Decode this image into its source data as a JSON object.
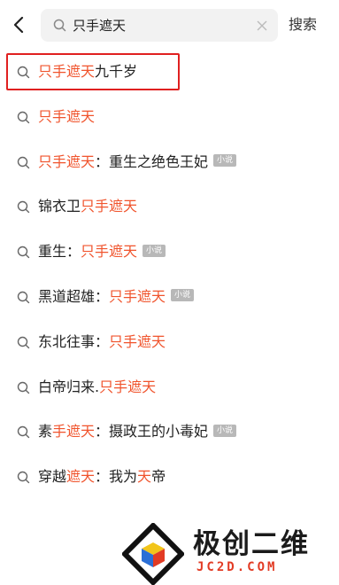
{
  "header": {
    "back_icon": "chevron-left-icon",
    "search_icon": "search-icon",
    "query": "只手遮天",
    "clear_icon": "close-icon",
    "search_button": "搜索"
  },
  "suggestions": [
    {
      "parts": [
        {
          "t": "只手遮天",
          "hl": true
        },
        {
          "t": "九千岁",
          "hl": false
        }
      ],
      "tag": null
    },
    {
      "parts": [
        {
          "t": "只手遮天",
          "hl": true
        }
      ],
      "tag": null
    },
    {
      "parts": [
        {
          "t": "只手遮天",
          "hl": true
        },
        {
          "t": "：重生之绝色王妃",
          "hl": false
        }
      ],
      "tag": "小说"
    },
    {
      "parts": [
        {
          "t": "锦衣卫",
          "hl": false
        },
        {
          "t": "只手遮天",
          "hl": true
        }
      ],
      "tag": null
    },
    {
      "parts": [
        {
          "t": "重生：",
          "hl": false
        },
        {
          "t": "只手遮天",
          "hl": true
        }
      ],
      "tag": "小说"
    },
    {
      "parts": [
        {
          "t": "黑道超雄：",
          "hl": false
        },
        {
          "t": "只手遮天",
          "hl": true
        }
      ],
      "tag": "小说"
    },
    {
      "parts": [
        {
          "t": "东北往事：",
          "hl": false
        },
        {
          "t": "只手遮天",
          "hl": true
        }
      ],
      "tag": null
    },
    {
      "parts": [
        {
          "t": "白帝归来.",
          "hl": false
        },
        {
          "t": "只手遮天",
          "hl": true
        }
      ],
      "tag": null
    },
    {
      "parts": [
        {
          "t": "素",
          "hl": false
        },
        {
          "t": "手遮天",
          "hl": true
        },
        {
          "t": "：摄政王的小毒妃",
          "hl": false
        }
      ],
      "tag": "小说"
    },
    {
      "parts": [
        {
          "t": "穿越",
          "hl": false
        },
        {
          "t": "遮天",
          "hl": true
        },
        {
          "t": "：我为",
          "hl": false
        },
        {
          "t": "天",
          "hl": true
        },
        {
          "t": "帝",
          "hl": false
        }
      ],
      "tag": null
    }
  ],
  "watermark": {
    "title": "极创二维",
    "url": "JC2D.COM"
  },
  "colors": {
    "highlight": "#f0542d",
    "annotation_box": "#e02020",
    "tag_bg": "#b8b8b8"
  }
}
